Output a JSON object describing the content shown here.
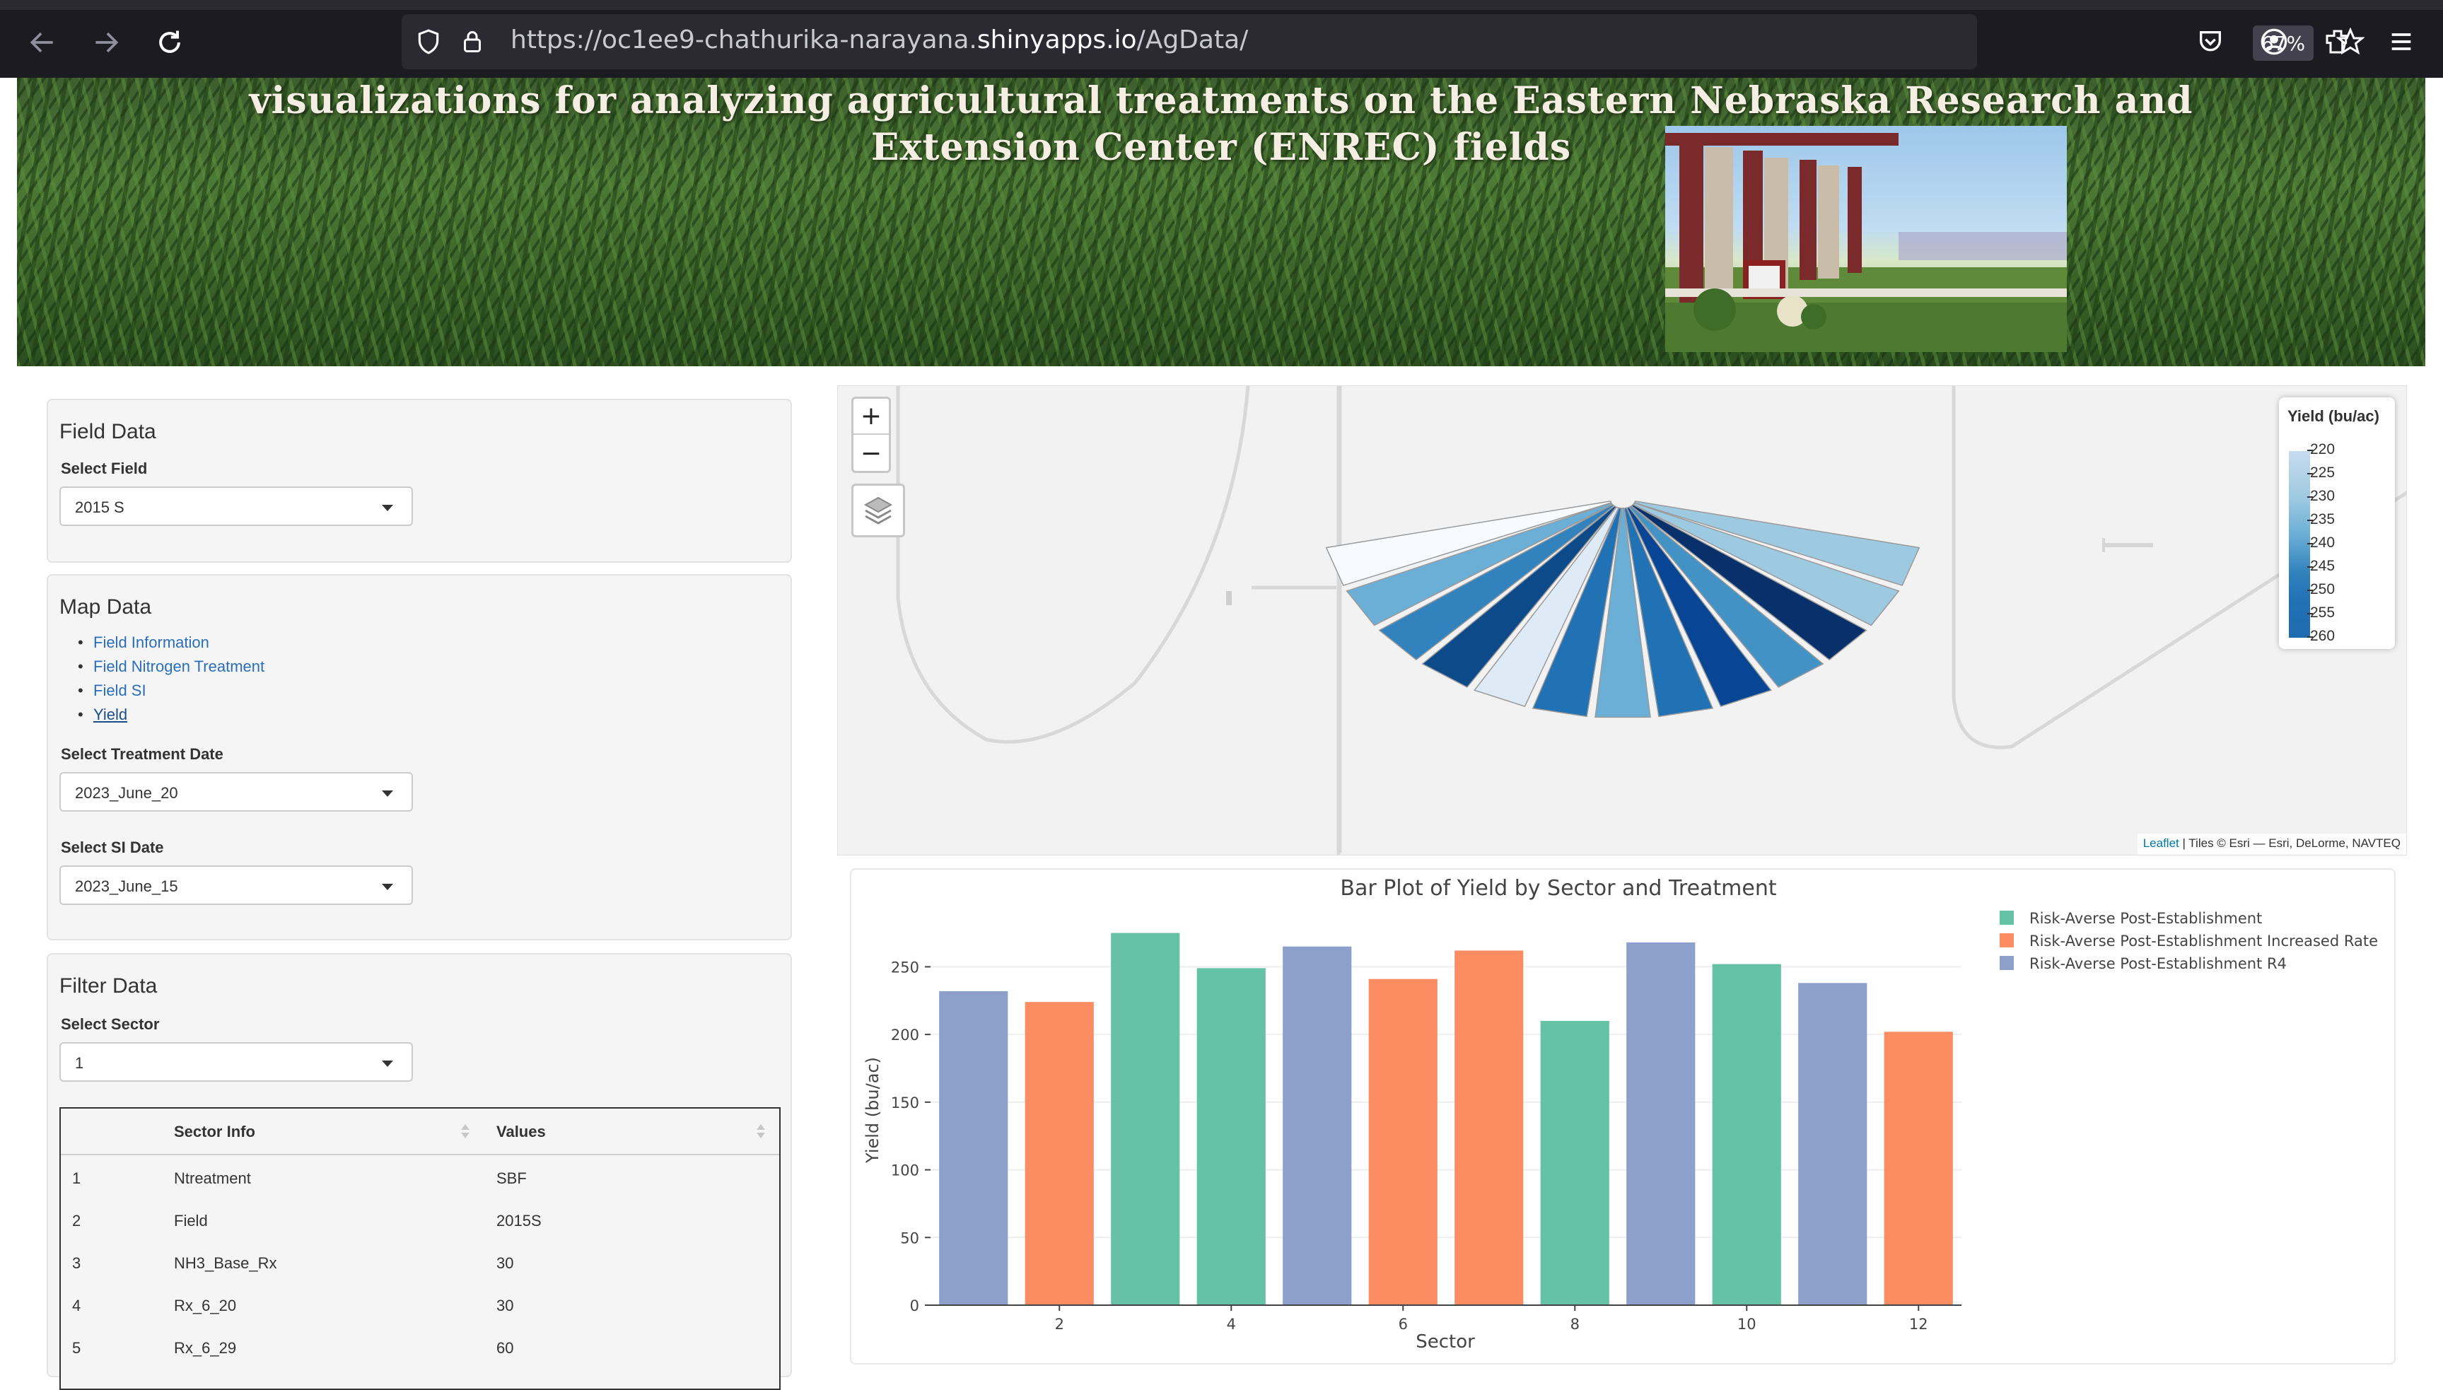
{
  "browser": {
    "url_prefix": "https://oc1ee9-chathurika-narayana.",
    "url_host": "shinyapps.io",
    "url_path": "/AgData/",
    "zoom": "67%",
    "icons": [
      "back-arrow-icon",
      "forward-arrow-icon",
      "reload-icon",
      "shield-icon",
      "lock-icon",
      "star-icon",
      "pocket-icon",
      "account-icon",
      "extensions-icon",
      "menu-icon"
    ]
  },
  "banner": {
    "title_line1": "visualizations for analyzing agricultural treatments on the Eastern Nebraska Research and",
    "title_line2": "Extension Center (ENREC) fields"
  },
  "field_panel": {
    "heading": "Field Data",
    "select_field_label": "Select Field",
    "select_field_value": "2015 S"
  },
  "map_panel": {
    "heading": "Map Data",
    "links": [
      "Field Information",
      "Field Nitrogen Treatment",
      "Field SI",
      "Yield"
    ],
    "active_link": "Yield",
    "treatment_date_label": "Select Treatment Date",
    "treatment_date_value": "2023_June_20",
    "si_date_label": "Select SI Date",
    "si_date_value": "2023_June_15"
  },
  "filter_panel": {
    "heading": "Filter Data",
    "sector_label": "Select Sector",
    "sector_value": "1",
    "table": {
      "columns": [
        "",
        "Sector Info",
        "Values"
      ],
      "rows": [
        [
          "1",
          "Ntreatment",
          "SBF"
        ],
        [
          "2",
          "Field",
          "2015S"
        ],
        [
          "3",
          "NH3_Base_Rx",
          "30"
        ],
        [
          "4",
          "Rx_6_20",
          "30"
        ],
        [
          "5",
          "Rx_6_29",
          "60"
        ]
      ]
    }
  },
  "map": {
    "zoom_in": "+",
    "zoom_out": "−",
    "legend_title": "Yield (bu/ac)",
    "legend_ticks": [
      "220",
      "225",
      "230",
      "235",
      "240",
      "245",
      "250",
      "255",
      "260"
    ],
    "attribution_link": "Leaflet",
    "attribution_text": " | Tiles © Esri — Esri, DeLorme, NAVTEQ",
    "wedge_colors": [
      "#f7fbff",
      "#6baed6",
      "#3182bd",
      "#0d4a8a",
      "#deebf7",
      "#2171b5",
      "#6baed6",
      "#2171b5",
      "#084594",
      "#4292c6",
      "#08306b",
      "#9ecae1",
      "#9ecae1"
    ]
  },
  "chart_data": {
    "type": "bar",
    "title": "Bar Plot of Yield by Sector and Treatment",
    "xlabel": "Sector",
    "ylabel": "Yield (bu/ac)",
    "ylim": [
      0,
      280
    ],
    "yticks": [
      0,
      50,
      100,
      150,
      200,
      250
    ],
    "xticks": [
      2,
      4,
      6,
      8,
      10,
      12
    ],
    "legend_position": "top-right",
    "series": [
      {
        "name": "Risk-Averse Post-Establishment",
        "color": "#66c2a5"
      },
      {
        "name": "Risk-Averse Post-Establishment Increased Rate",
        "color": "#fc8d62"
      },
      {
        "name": "Risk-Averse Post-Establishment R4",
        "color": "#8da0cb"
      }
    ],
    "bars": [
      {
        "x": 1,
        "value": 232,
        "series": 2
      },
      {
        "x": 2,
        "value": 224,
        "series": 1
      },
      {
        "x": 3,
        "value": 275,
        "series": 0
      },
      {
        "x": 4,
        "value": 249,
        "series": 0
      },
      {
        "x": 5,
        "value": 265,
        "series": 2
      },
      {
        "x": 6,
        "value": 241,
        "series": 1
      },
      {
        "x": 7,
        "value": 262,
        "series": 1
      },
      {
        "x": 8,
        "value": 210,
        "series": 0
      },
      {
        "x": 9,
        "value": 268,
        "series": 2
      },
      {
        "x": 10,
        "value": 252,
        "series": 0
      },
      {
        "x": 11,
        "value": 238,
        "series": 2
      },
      {
        "x": 12,
        "value": 202,
        "series": 1
      }
    ]
  }
}
